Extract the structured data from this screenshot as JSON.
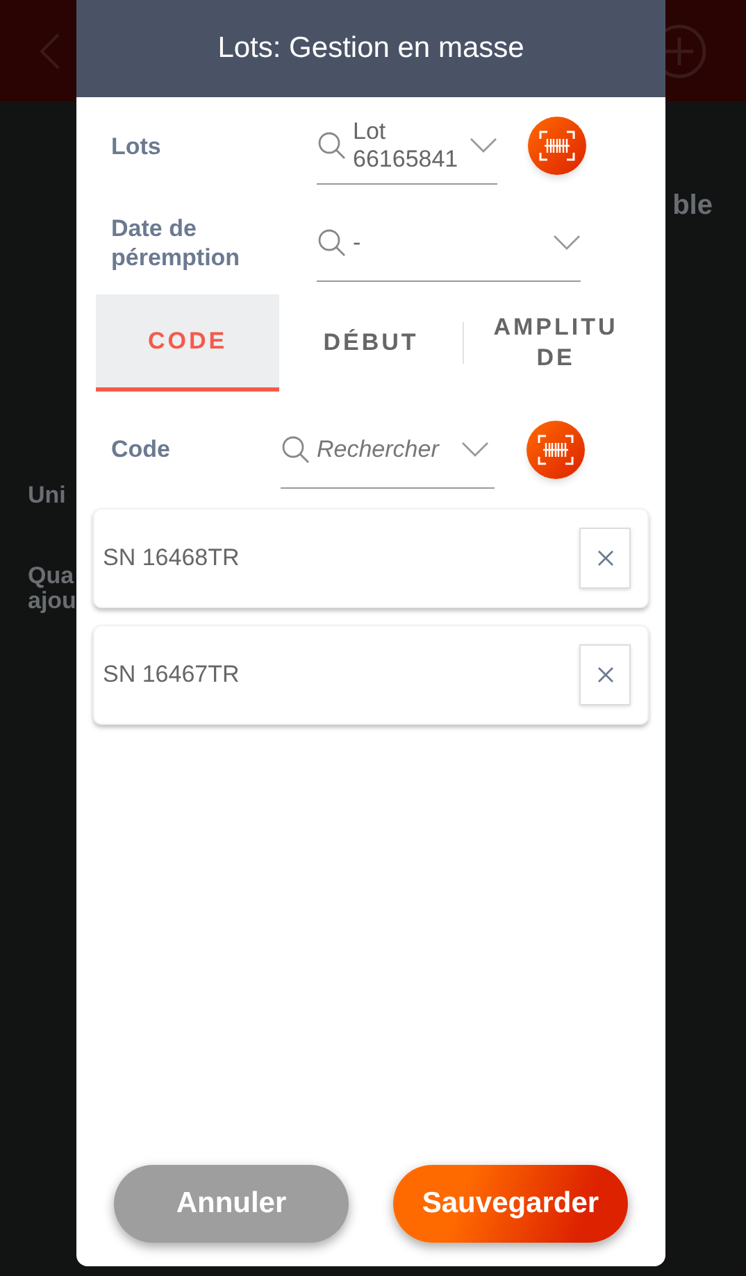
{
  "background": {
    "texts": [
      {
        "text": "ble",
        "kind": "right"
      },
      {
        "text": "Uni",
        "kind": "left"
      },
      {
        "text": "Qua\najou",
        "kind": "left"
      }
    ]
  },
  "dialog": {
    "title": "Lots: Gestion en masse",
    "fields": [
      {
        "label": "Lots",
        "value": "Lot 66165841",
        "scan": true
      },
      {
        "label": "Date de péremption",
        "value": "-",
        "scan": false
      }
    ],
    "tabs": [
      {
        "label": "CODE",
        "selected": true
      },
      {
        "label": "DÉBUT",
        "selected": false
      },
      {
        "label": "AMPLITUDE",
        "selected": false
      }
    ],
    "code": {
      "label": "Code",
      "placeholder": "Rechercher",
      "scan": true
    },
    "items": [
      {
        "text": "SN 16468TR"
      },
      {
        "text": "SN 16467TR"
      }
    ],
    "buttons": [
      {
        "label": "Annuler",
        "kind": "cancel"
      },
      {
        "label": "Sauvegarder",
        "kind": "primary"
      }
    ]
  }
}
